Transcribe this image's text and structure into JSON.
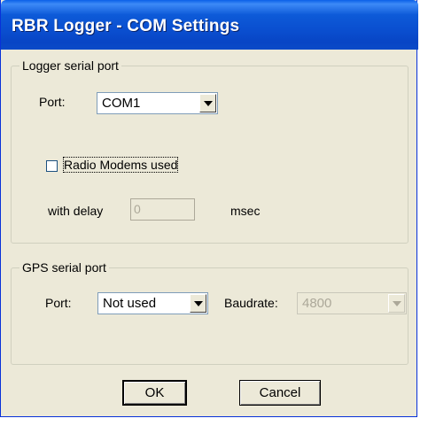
{
  "window": {
    "title": "RBR Logger - COM Settings"
  },
  "logger_group": {
    "legend": "Logger serial port",
    "port_label": "Port:",
    "port_value": "COM1",
    "radio_modems_label": "Radio Modems used",
    "radio_modems_checked": false,
    "delay_label": "with delay",
    "delay_value": "0",
    "delay_unit": "msec"
  },
  "gps_group": {
    "legend": "GPS serial port",
    "port_label": "Port:",
    "port_value": "Not used",
    "baudrate_label": "Baudrate:",
    "baudrate_value": "4800"
  },
  "buttons": {
    "ok": "OK",
    "cancel": "Cancel"
  },
  "colors": {
    "title_bar": "#0a4fd0",
    "dialog_bg": "#ece9d8",
    "disabled_text": "#aca899"
  }
}
